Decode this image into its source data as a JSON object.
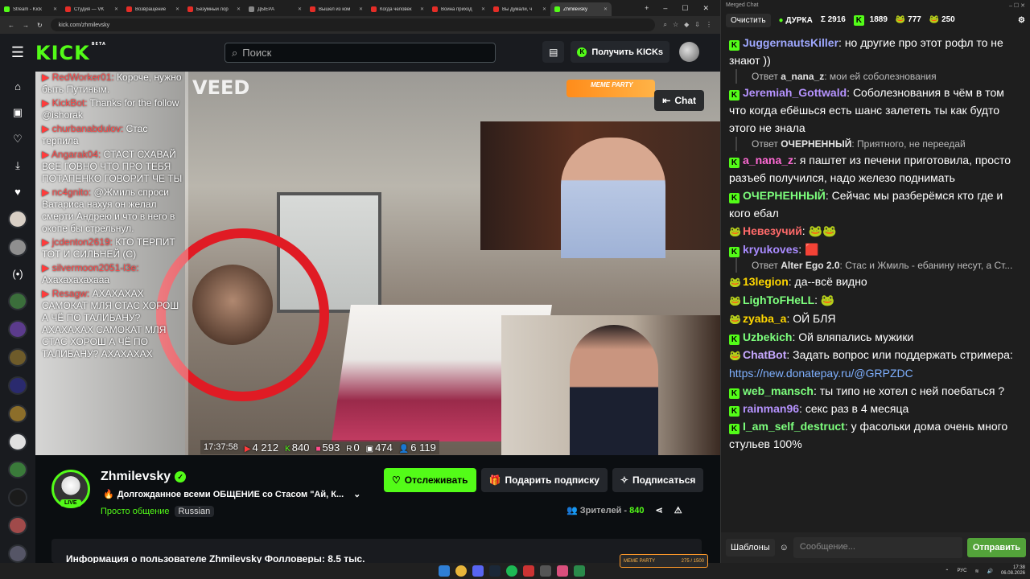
{
  "browser": {
    "tabs": [
      {
        "label": "Stream - Kick",
        "color": "#53fc18"
      },
      {
        "label": "Студия — VK",
        "color": "#e52d27"
      },
      {
        "label": "Возвращение",
        "color": "#e52d27"
      },
      {
        "label": "Безумный лор",
        "color": "#e52d27"
      },
      {
        "label": "ДЫЕРА",
        "color": "#888888"
      },
      {
        "label": "Вышел из ком",
        "color": "#e52d27"
      },
      {
        "label": "Когда человек",
        "color": "#e52d27"
      },
      {
        "label": "Война приход",
        "color": "#e52d27"
      },
      {
        "label": "Вы думали, ч",
        "color": "#e52d27"
      },
      {
        "label": "Zhmilevsky",
        "color": "#53fc18",
        "active": true
      }
    ],
    "url": "kick.com/zhmilevsky"
  },
  "header": {
    "logo": "KICK",
    "logo_badge": "BETA",
    "search_placeholder": "Поиск",
    "get_kicks_label": "Получить KICKs"
  },
  "video": {
    "overlay_chat": [
      {
        "name": "RedWorker01:",
        "text": "Короче, нужно быть Путиным."
      },
      {
        "name": "KickBot:",
        "text": "Thanks for the follow @ishorak"
      },
      {
        "name": "churbanabdulov:",
        "text": "Стас терпила"
      },
      {
        "name": "Angarak04:",
        "text": "СТАСТ СХАВАЙ ВСЕ ГОВНО ЧТО ПРО ТЕБЯ ПОТАПЕНКО ГОВОРИТ ЧЕ ТЫ"
      },
      {
        "name": "nc4gnito:",
        "text": "@Жмиль спроси Ватариса нахуя он желал смерти Андрею и что в него в окопе бы стрельнул."
      },
      {
        "name": "jcdenton2619:",
        "text": "КТО ТЕРПИТ ТОТ И СИЛЬНЕЙ (С)"
      },
      {
        "name": "silvermoon2051-l3e:",
        "text": "Ахахахахахааа"
      },
      {
        "name": "Resagw:",
        "text": "АХАХАХАХ САМОКАТ МЛЯ СТАС ХОРОШ А ЧЁ ПО ТАЛИБАНУ? АХАХАХАХ САМОКАТ МЛЯ СТАС ХОРОШ А ЧЁ ПО ТАЛИБАНУ? АХАХАХАХ"
      }
    ],
    "watermark": "VEED",
    "meme_party": "MEME PARTY",
    "chat_toggle_label": "Chat",
    "stats": {
      "time": "17:37:58",
      "youtube": "4 212",
      "kick": "840",
      "vk": "593",
      "rutube": "0",
      "other": "474",
      "total": "6 119"
    }
  },
  "channel": {
    "name": "Zhmilevsky",
    "live_label": "LIVE",
    "title": "Долгожданное всеми ОБЩЕНИЕ со Стасом \"Ай, К...",
    "category": "Просто общение",
    "language_tag": "Russian",
    "follow_label": "Отслеживать",
    "gift_label": "Подарить подписку",
    "subscribe_label": "Подписаться",
    "viewers_label": "Зрителей -",
    "viewers_count": "840",
    "about_text": "Информация о пользователе Zhmilevsky  Фолловеры: 8.5 тыс."
  },
  "merged_chat": {
    "window_title": "Merged Chat",
    "clear_label": "Очистить",
    "poll_label": "ДУРКА",
    "totals": [
      {
        "icon": "Σ",
        "value": "2916"
      },
      {
        "icon": "K",
        "value": "1889"
      },
      {
        "icon": "pepe",
        "value": "777"
      },
      {
        "icon": "pepe",
        "value": "250"
      }
    ],
    "messages": [
      {
        "badge": "kick",
        "user": "JuggernautsKiller",
        "color": "#9fa8ff",
        "text": "но другие про этот рофл то не знают ))"
      },
      {
        "reply": true,
        "to": "a_nana_z",
        "text": "мои ей соболезнования"
      },
      {
        "badge": "kick",
        "user": "Jeremiah_Gottwald",
        "color": "#b693ff",
        "text": "Соболезнования в чём в том что когда ебёшься есть шанс залететь ты как будто этого не знала"
      },
      {
        "reply": true,
        "to": "ОЧЕРНЕННЫЙ",
        "text": "Приятного, не переедай"
      },
      {
        "badge": "kick",
        "user": "a_nana_z",
        "color": "#ff6ad5",
        "text": "я паштет из печени приготовила, просто разъеб получился, надо железо поднимать"
      },
      {
        "badge": "kick",
        "user": "ОЧЕРНЕННЫЙ",
        "color": "#7dff7d",
        "text": "Сейчас мы разберёмся кто где и кого ебал"
      },
      {
        "badge": "pepe",
        "user": "Невезучий",
        "color": "#ff6a6a",
        "text": "🐸🐸"
      },
      {
        "badge": "kick",
        "user": "kryukoves",
        "color": "#a98bff",
        "text": "🟥"
      },
      {
        "reply": true,
        "to": "Alter Ego 2.0",
        "text": "Стас и Жмиль - ебанину несут, а Ст..."
      },
      {
        "badge": "pepe",
        "user": "13legion",
        "color": "#ffd700",
        "text": "да--всё  видно"
      },
      {
        "badge": "pepe",
        "user": "LighToFHeLL",
        "color": "#7dff7d",
        "text": "🐸"
      },
      {
        "badge": "pepe",
        "user": "zyaba_a",
        "color": "#ffd700",
        "text": "ОЙ БЛЯ"
      },
      {
        "badge": "kick",
        "user": "Uzbekich",
        "color": "#7dff7d",
        "text": "Ой вляпались мужики"
      },
      {
        "badge": "pepe",
        "user": "ChatBot",
        "color": "#c7a8ff",
        "text": "Задать вопрос или поддержать стримера: ",
        "link": "https://new.donatepay.ru/@GRPZDC"
      },
      {
        "badge": "kick",
        "user": "web_mansch",
        "color": "#7dff7d",
        "text": "ты типо не хотел с ней поебаться ?"
      },
      {
        "badge": "kick",
        "user": "rainman96",
        "color": "#b693ff",
        "text": "секс раз в 4 месяца"
      },
      {
        "badge": "kick",
        "user": "I_am_self_destruct",
        "color": "#7dff7d",
        "text": "у фасольки дома очень много стульев 100%"
      }
    ],
    "templates_label": "Шаблоны",
    "input_placeholder": "Сообщение...",
    "send_label": "Отправить"
  },
  "taskbar": {
    "overlay_label": "MEME PARTY",
    "overlay_count": "275 / 1500",
    "lang": "РУС",
    "time": "17:38",
    "date": "06.08.2026"
  }
}
